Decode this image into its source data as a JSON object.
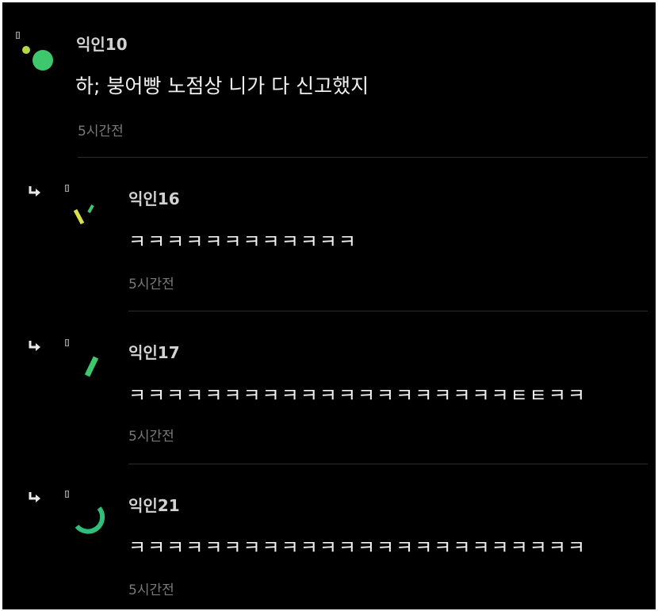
{
  "thread": {
    "comment": {
      "author": "익인10",
      "text": "하; 붕어빵 노점상 니가 다 신고했지",
      "time": "5시간전",
      "avatar_color": "#3fc76d"
    },
    "replies": [
      {
        "author": "익인16",
        "text": "ㅋㅋㅋㅋㅋㅋㅋㅋㅋㅋㅋㅋ",
        "time": "5시간전",
        "avatar_colors": [
          "#d8e04a",
          "#3fc76d"
        ]
      },
      {
        "author": "익인17",
        "text": "ㅋㅋㅋㅋㅋㅋㅋㅋㅋㅋㅋㅋㅋㅋㅋㅋㅋㅋㅋㅋㅌㅌㅋㅋ",
        "time": "5시간전",
        "avatar_colors": [
          "#3fc76d"
        ]
      },
      {
        "author": "익인21",
        "text": "ㅋㅋㅋㅋㅋㅋㅋㅋㅋㅋㅋㅋㅋㅋㅋㅋㅋㅋㅋㅋㅋㅋㅋㅋ",
        "time": "5시간전",
        "avatar_colors": [
          "#2fbf7a"
        ]
      }
    ]
  },
  "icons": {
    "reply": "reply-arrow-icon",
    "badge": "badge-icon"
  }
}
